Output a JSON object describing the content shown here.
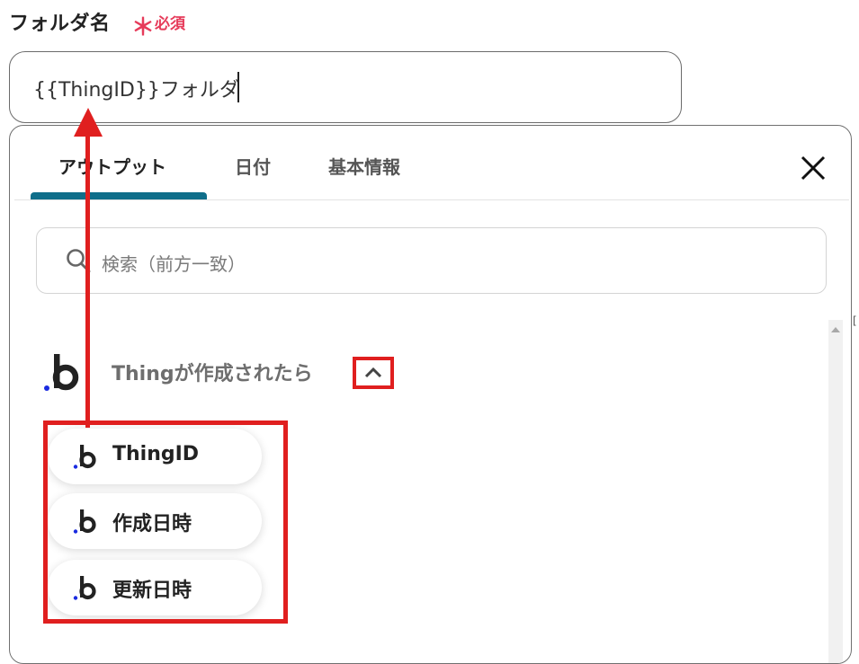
{
  "field": {
    "label": "フォルダ名",
    "required_mark": "＊",
    "required_text": "必須",
    "value": "{{ThingID}}フォルダ"
  },
  "tabs": [
    {
      "label": "アウトプット",
      "active": true
    },
    {
      "label": "日付",
      "active": false
    },
    {
      "label": "基本情報",
      "active": false
    }
  ],
  "search": {
    "placeholder": "検索（前方一致）"
  },
  "section": {
    "title": "Thingが作成されたら"
  },
  "outputs": [
    {
      "label": "ThingID"
    },
    {
      "label": "作成日時"
    },
    {
      "label": "更新日時"
    }
  ],
  "colors": {
    "accent_tab": "#0f6e8a",
    "required": "#e63b5a",
    "annotation": "#e01f1f",
    "logo_dot": "#1a2be0"
  },
  "icons": [
    "close-icon",
    "search-icon",
    "chevron-up-icon",
    "app-logo-icon"
  ]
}
